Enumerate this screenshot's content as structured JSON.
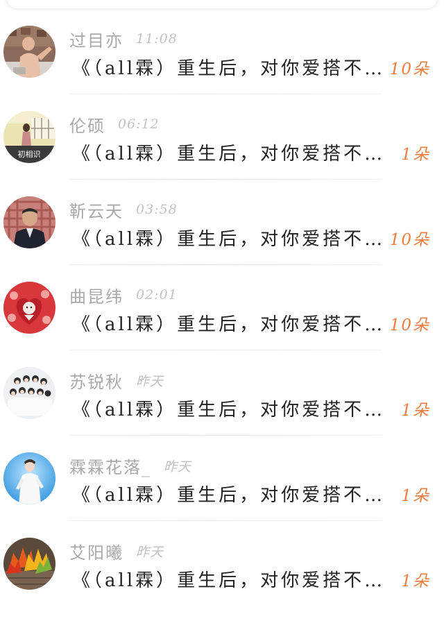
{
  "conversations": [
    {
      "name": "过目亦",
      "time": "11:08",
      "message": "《（all霖）重生后，对你爱搭不…",
      "count": "10朵",
      "avatar_icon": "shirtless-man-photo-avatar"
    },
    {
      "name": "伦硕",
      "time": "06:12",
      "message": "《（all霖）重生后，对你爱搭不…",
      "count": "1朵",
      "avatar_icon": "girl-yellow-background-avatar"
    },
    {
      "name": "靳云天",
      "time": "03:58",
      "message": "《（all霖）重生后，对你爱搭不…",
      "count": "10朵",
      "avatar_icon": "man-plaid-background-avatar"
    },
    {
      "name": "曲昆纬",
      "time": "02:01",
      "message": "《（all霖）重生后，对你爱搭不…",
      "count": "10朵",
      "avatar_icon": "red-floral-heart-avatar"
    },
    {
      "name": "苏锐秋",
      "time": "昨天",
      "message": "《（all霖）重生后，对你爱搭不…",
      "count": "1朵",
      "avatar_icon": "group-photo-avatar"
    },
    {
      "name": "霖霖花落_",
      "time": "昨天",
      "message": "《（all霖）重生后，对你爱搭不…",
      "count": "1朵",
      "avatar_icon": "performer-blue-stage-avatar"
    },
    {
      "name": "艾阳曦",
      "time": "昨天",
      "message": "《（all霖）重生后，对你爱搭不…",
      "count": "1朵",
      "avatar_icon": "autumn-leaves-avatar"
    }
  ]
}
